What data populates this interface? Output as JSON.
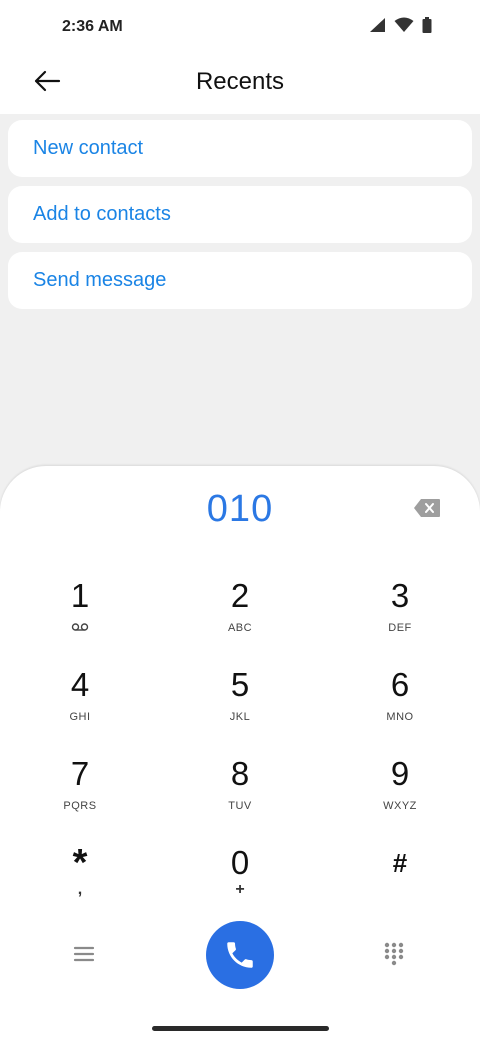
{
  "status_bar": {
    "time": "2:36 AM",
    "icons": [
      "signal-icon",
      "wifi-icon",
      "battery-icon"
    ]
  },
  "header": {
    "title": "Recents",
    "back_icon": "arrow-left-icon"
  },
  "options": [
    {
      "label": "New contact"
    },
    {
      "label": "Add to contacts"
    },
    {
      "label": "Send message"
    }
  ],
  "dialer": {
    "number": "010",
    "backspace_icon": "backspace-icon",
    "keys": [
      {
        "digit": "1",
        "letters": ""
      },
      {
        "digit": "2",
        "letters": "ABC"
      },
      {
        "digit": "3",
        "letters": "DEF"
      },
      {
        "digit": "4",
        "letters": "GHI"
      },
      {
        "digit": "5",
        "letters": "JKL"
      },
      {
        "digit": "6",
        "letters": "MNO"
      },
      {
        "digit": "7",
        "letters": "PQRS"
      },
      {
        "digit": "8",
        "letters": "TUV"
      },
      {
        "digit": "9",
        "letters": "WXYZ"
      },
      {
        "digit": "*",
        "letters": ","
      },
      {
        "digit": "0",
        "letters": "+"
      },
      {
        "digit": "#",
        "letters": ""
      }
    ]
  },
  "bottom_bar": {
    "menu_icon": "menu-icon",
    "call_icon": "phone-icon",
    "keypad_icon": "dialpad-icon"
  },
  "colors": {
    "accent": "#1a84e5",
    "call_button": "#2a6fe3",
    "dial_number": "#2b78e4",
    "background": "#f0f0f0"
  }
}
